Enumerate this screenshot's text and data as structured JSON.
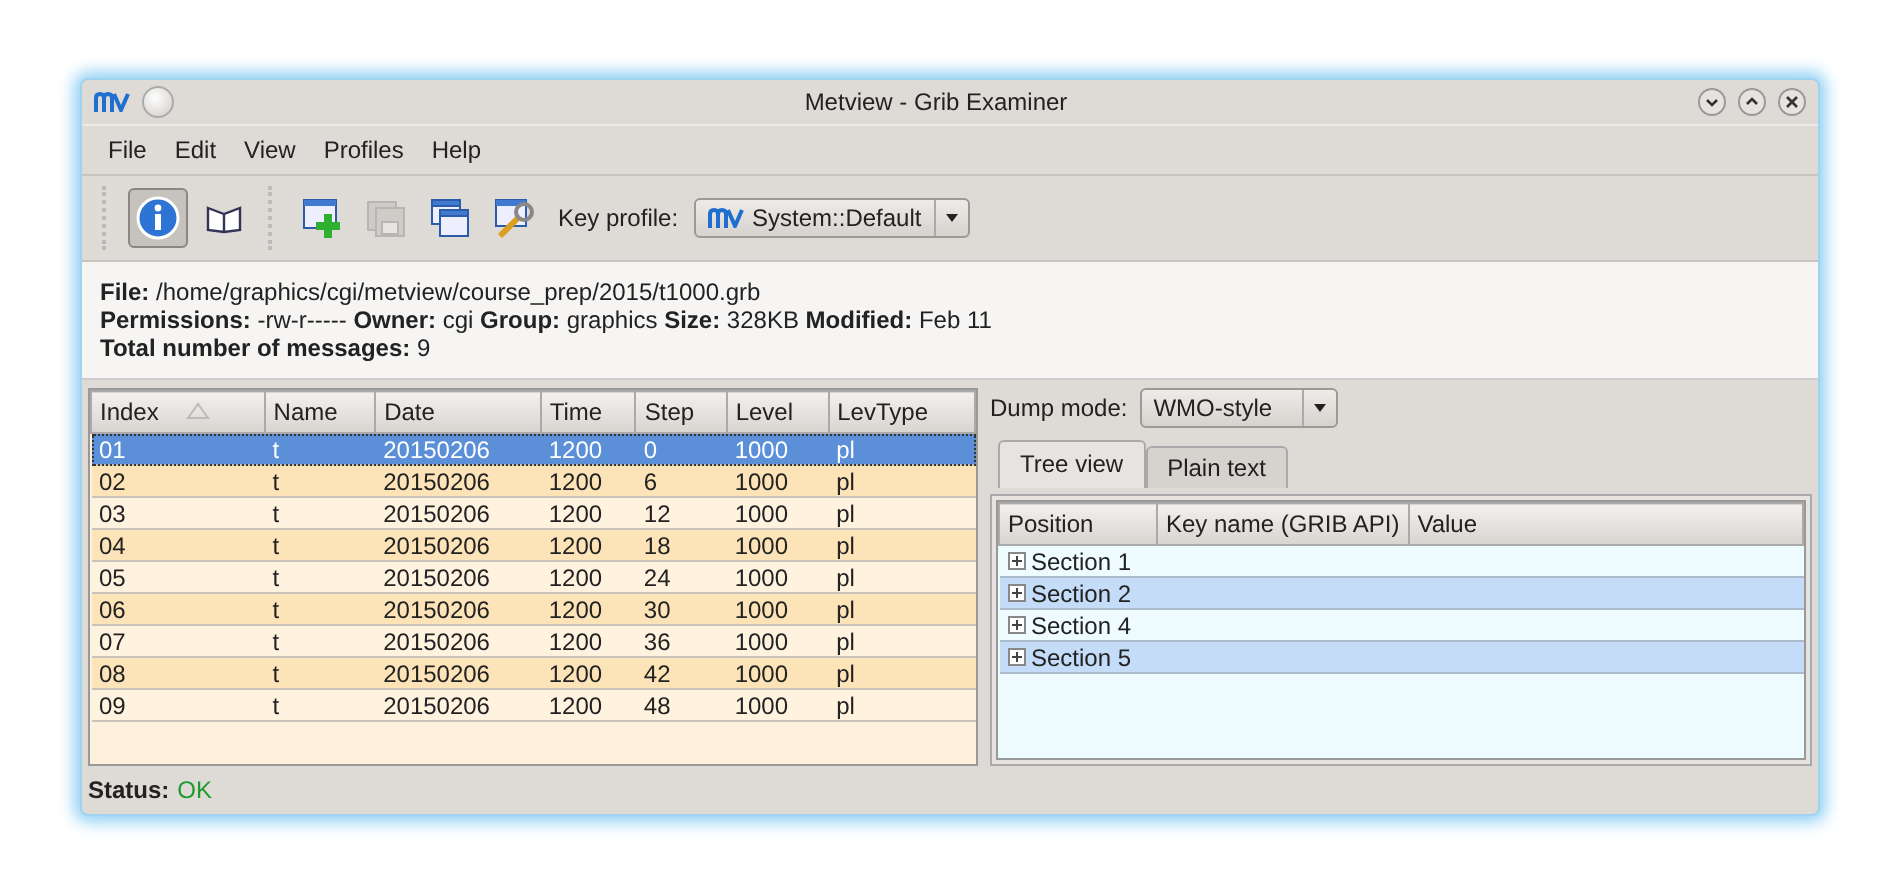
{
  "window": {
    "title": "Metview - Grib Examiner"
  },
  "menu": [
    "File",
    "Edit",
    "View",
    "Profiles",
    "Help"
  ],
  "toolbar": {
    "tools": [
      {
        "kind": "info",
        "selected": true
      },
      {
        "kind": "book",
        "selected": false
      }
    ],
    "actions": [
      {
        "kind": "add",
        "disabled": false
      },
      {
        "kind": "save",
        "disabled": true
      },
      {
        "kind": "windows",
        "disabled": false
      },
      {
        "kind": "tools",
        "disabled": false
      }
    ],
    "key_profile": {
      "label": "Key profile:",
      "value": "System::Default"
    }
  },
  "info": [
    "**File:** /home/graphics/cgi/metview/course_prep/2015/t1000.grb",
    "**Permissions:** -rw-r----- **Owner:** cgi **Group:** graphics **Size:** 328KB **Modified:** Feb 11",
    "**Total number of messages:** 9"
  ],
  "table": {
    "columns": [
      "Index",
      "Name",
      "Date",
      "Time",
      "Step",
      "Level",
      "LevType"
    ],
    "rows": [
      {
        "cells": [
          "01",
          "t",
          "20150206",
          "1200",
          "0",
          "1000",
          "pl"
        ],
        "selected": true
      },
      {
        "cells": [
          "02",
          "t",
          "20150206",
          "1200",
          "6",
          "1000",
          "pl"
        ],
        "selected": false
      },
      {
        "cells": [
          "03",
          "t",
          "20150206",
          "1200",
          "12",
          "1000",
          "pl"
        ],
        "selected": false
      },
      {
        "cells": [
          "04",
          "t",
          "20150206",
          "1200",
          "18",
          "1000",
          "pl"
        ],
        "selected": false
      },
      {
        "cells": [
          "05",
          "t",
          "20150206",
          "1200",
          "24",
          "1000",
          "pl"
        ],
        "selected": false
      },
      {
        "cells": [
          "06",
          "t",
          "20150206",
          "1200",
          "30",
          "1000",
          "pl"
        ],
        "selected": false
      },
      {
        "cells": [
          "07",
          "t",
          "20150206",
          "1200",
          "36",
          "1000",
          "pl"
        ],
        "selected": false
      },
      {
        "cells": [
          "08",
          "t",
          "20150206",
          "1200",
          "42",
          "1000",
          "pl"
        ],
        "selected": false
      },
      {
        "cells": [
          "09",
          "t",
          "20150206",
          "1200",
          "48",
          "1000",
          "pl"
        ],
        "selected": false
      }
    ]
  },
  "dump_mode": {
    "label": "Dump mode:",
    "value": "WMO-style"
  },
  "tabs": [
    {
      "label": "Tree view",
      "selected": true
    },
    {
      "label": "Plain text",
      "selected": false
    }
  ],
  "tree": {
    "columns": [
      "Position",
      "Key name (GRIB API)",
      "Value"
    ],
    "items": [
      {
        "label": "Section 1",
        "expanded": false
      },
      {
        "label": "Section 2",
        "expanded": false
      },
      {
        "label": "Section 4",
        "expanded": false
      },
      {
        "label": "Section 5",
        "expanded": false
      }
    ]
  },
  "status": {
    "label": "Status:",
    "value": "OK"
  }
}
